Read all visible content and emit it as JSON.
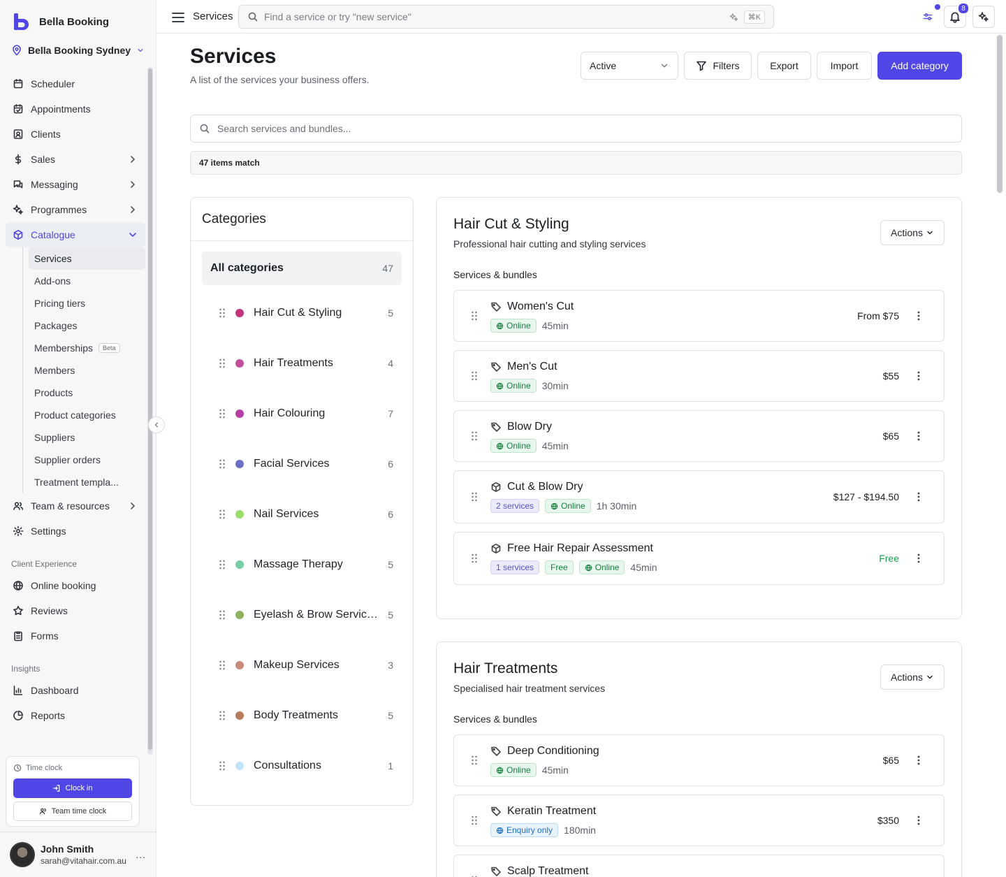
{
  "brand": {
    "name": "Bella Booking"
  },
  "location": {
    "name": "Bella Booking Sydney"
  },
  "nav": {
    "items": [
      {
        "label": "Scheduler"
      },
      {
        "label": "Appointments"
      },
      {
        "label": "Clients"
      },
      {
        "label": "Sales"
      },
      {
        "label": "Messaging"
      },
      {
        "label": "Programmes"
      },
      {
        "label": "Catalogue"
      }
    ],
    "catalogue_sub": [
      {
        "label": "Services"
      },
      {
        "label": "Add-ons"
      },
      {
        "label": "Pricing tiers"
      },
      {
        "label": "Packages"
      },
      {
        "label": "Memberships",
        "badge": "Beta"
      },
      {
        "label": "Members"
      },
      {
        "label": "Products"
      },
      {
        "label": "Product categories"
      },
      {
        "label": "Suppliers"
      },
      {
        "label": "Supplier orders"
      },
      {
        "label": "Treatment templa..."
      }
    ],
    "after": [
      {
        "label": "Team & resources"
      },
      {
        "label": "Settings"
      }
    ],
    "client_experience": {
      "label": "Client Experience",
      "items": [
        {
          "label": "Online booking"
        },
        {
          "label": "Reviews"
        },
        {
          "label": "Forms"
        }
      ]
    },
    "insights": {
      "label": "Insights",
      "items": [
        {
          "label": "Dashboard"
        },
        {
          "label": "Reports"
        }
      ]
    }
  },
  "timeclock": {
    "title": "Time clock",
    "clock_in": "Clock in",
    "team": "Team time clock"
  },
  "user": {
    "name": "John Smith",
    "email": "sarah@vitahair.com.au",
    "more": "..."
  },
  "topbar": {
    "title": "Services",
    "search_placeholder": "Find a service or try \"new service\"",
    "shortcut": "⌘K",
    "notifications": "8"
  },
  "header": {
    "title": "Services",
    "subtitle": "A list of the services your business offers.",
    "status": "Active",
    "filters": "Filters",
    "export": "Export",
    "import": "Import",
    "add_category": "Add category"
  },
  "search": {
    "placeholder": "Search services and bundles..."
  },
  "match": "47 items match",
  "categories": {
    "title": "Categories",
    "all": {
      "label": "All categories",
      "count": "47"
    },
    "items": [
      {
        "name": "Hair Cut & Styling",
        "count": "5",
        "color": "#c2337a"
      },
      {
        "name": "Hair Treatments",
        "count": "4",
        "color": "#c24f9e"
      },
      {
        "name": "Hair Colouring",
        "count": "7",
        "color": "#b63fa3"
      },
      {
        "name": "Facial Services",
        "count": "6",
        "color": "#6a6fc4"
      },
      {
        "name": "Nail Services",
        "count": "6",
        "color": "#9bdc6b"
      },
      {
        "name": "Massage Therapy",
        "count": "5",
        "color": "#74cfa6"
      },
      {
        "name": "Eyelash & Brow Services",
        "count": "5",
        "color": "#8fb35a"
      },
      {
        "name": "Makeup Services",
        "count": "3",
        "color": "#c98a7a"
      },
      {
        "name": "Body Treatments",
        "count": "5",
        "color": "#b87a5e"
      },
      {
        "name": "Consultations",
        "count": "1",
        "color": "#bfe3f7"
      }
    ]
  },
  "groups": [
    {
      "title": "Hair Cut & Styling",
      "description": "Professional hair cutting and styling services",
      "actions": "Actions",
      "sub": "Services & bundles",
      "services": [
        {
          "name": "Women's Cut",
          "icon": "tag-icon",
          "tags": [
            {
              "type": "online",
              "label": "Online"
            }
          ],
          "duration": "45min",
          "price": "From $75"
        },
        {
          "name": "Men's Cut",
          "icon": "tag-icon",
          "tags": [
            {
              "type": "online",
              "label": "Online"
            }
          ],
          "duration": "30min",
          "price": "$55"
        },
        {
          "name": "Blow Dry",
          "icon": "tag-icon",
          "tags": [
            {
              "type": "online",
              "label": "Online"
            }
          ],
          "duration": "45min",
          "price": "$65"
        },
        {
          "name": "Cut & Blow Dry",
          "icon": "box-icon",
          "tags": [
            {
              "type": "count",
              "label": "2 services"
            },
            {
              "type": "online",
              "label": "Online"
            }
          ],
          "duration": "1h 30min",
          "price": "$127 - $194.50"
        },
        {
          "name": "Free Hair Repair Assessment",
          "icon": "box-icon",
          "tags": [
            {
              "type": "count",
              "label": "1 services"
            },
            {
              "type": "free",
              "label": "Free"
            },
            {
              "type": "online",
              "label": "Online"
            }
          ],
          "duration": "45min",
          "price": "Free"
        }
      ]
    },
    {
      "title": "Hair Treatments",
      "description": "Specialised hair treatment services",
      "actions": "Actions",
      "sub": "Services & bundles",
      "services": [
        {
          "name": "Deep Conditioning",
          "icon": "tag-icon",
          "tags": [
            {
              "type": "online",
              "label": "Online"
            }
          ],
          "duration": "45min",
          "price": "$65"
        },
        {
          "name": "Keratin Treatment",
          "icon": "tag-icon",
          "tags": [
            {
              "type": "enquiry",
              "label": "Enquiry only"
            }
          ],
          "duration": "180min",
          "price": "$350"
        },
        {
          "name": "Scalp Treatment",
          "icon": "tag-icon",
          "tags": [],
          "duration": "",
          "price": ""
        }
      ]
    }
  ]
}
